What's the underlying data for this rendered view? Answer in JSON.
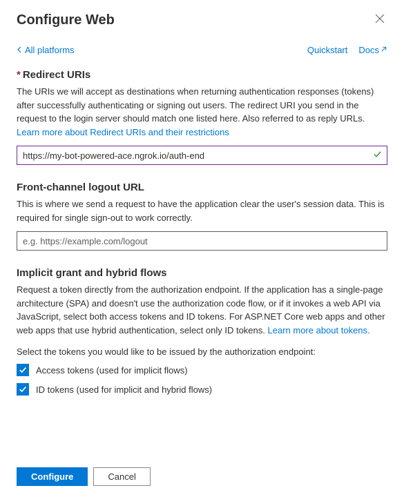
{
  "header": {
    "title": "Configure Web"
  },
  "nav": {
    "back_label": "All platforms",
    "quickstart_label": "Quickstart",
    "docs_label": "Docs"
  },
  "redirect": {
    "title": "Redirect URIs",
    "description": "The URIs we will accept as destinations when returning authentication responses (tokens) after successfully authenticating or signing out users. The redirect URI you send in the request to the login server should match one listed here. Also referred to as reply URLs. ",
    "learn_more": "Learn more about Redirect URIs and their restrictions",
    "value": "https://my-bot-powered-ace.ngrok.io/auth-end"
  },
  "front_channel": {
    "title": "Front-channel logout URL",
    "description": "This is where we send a request to have the application clear the user's session data. This is required for single sign-out to work correctly.",
    "placeholder": "e.g. https://example.com/logout"
  },
  "implicit": {
    "title": "Implicit grant and hybrid flows",
    "description": "Request a token directly from the authorization endpoint. If the application has a single-page architecture (SPA) and doesn't use the authorization code flow, or if it invokes a web API via JavaScript, select both access tokens and ID tokens. For ASP.NET Core web apps and other web apps that use hybrid authentication, select only ID tokens. ",
    "learn_more": "Learn more about tokens.",
    "prompt": "Select the tokens you would like to be issued by the authorization endpoint:",
    "access_tokens_label": "Access tokens (used for implicit flows)",
    "id_tokens_label": "ID tokens (used for implicit and hybrid flows)"
  },
  "footer": {
    "configure_label": "Configure",
    "cancel_label": "Cancel"
  }
}
